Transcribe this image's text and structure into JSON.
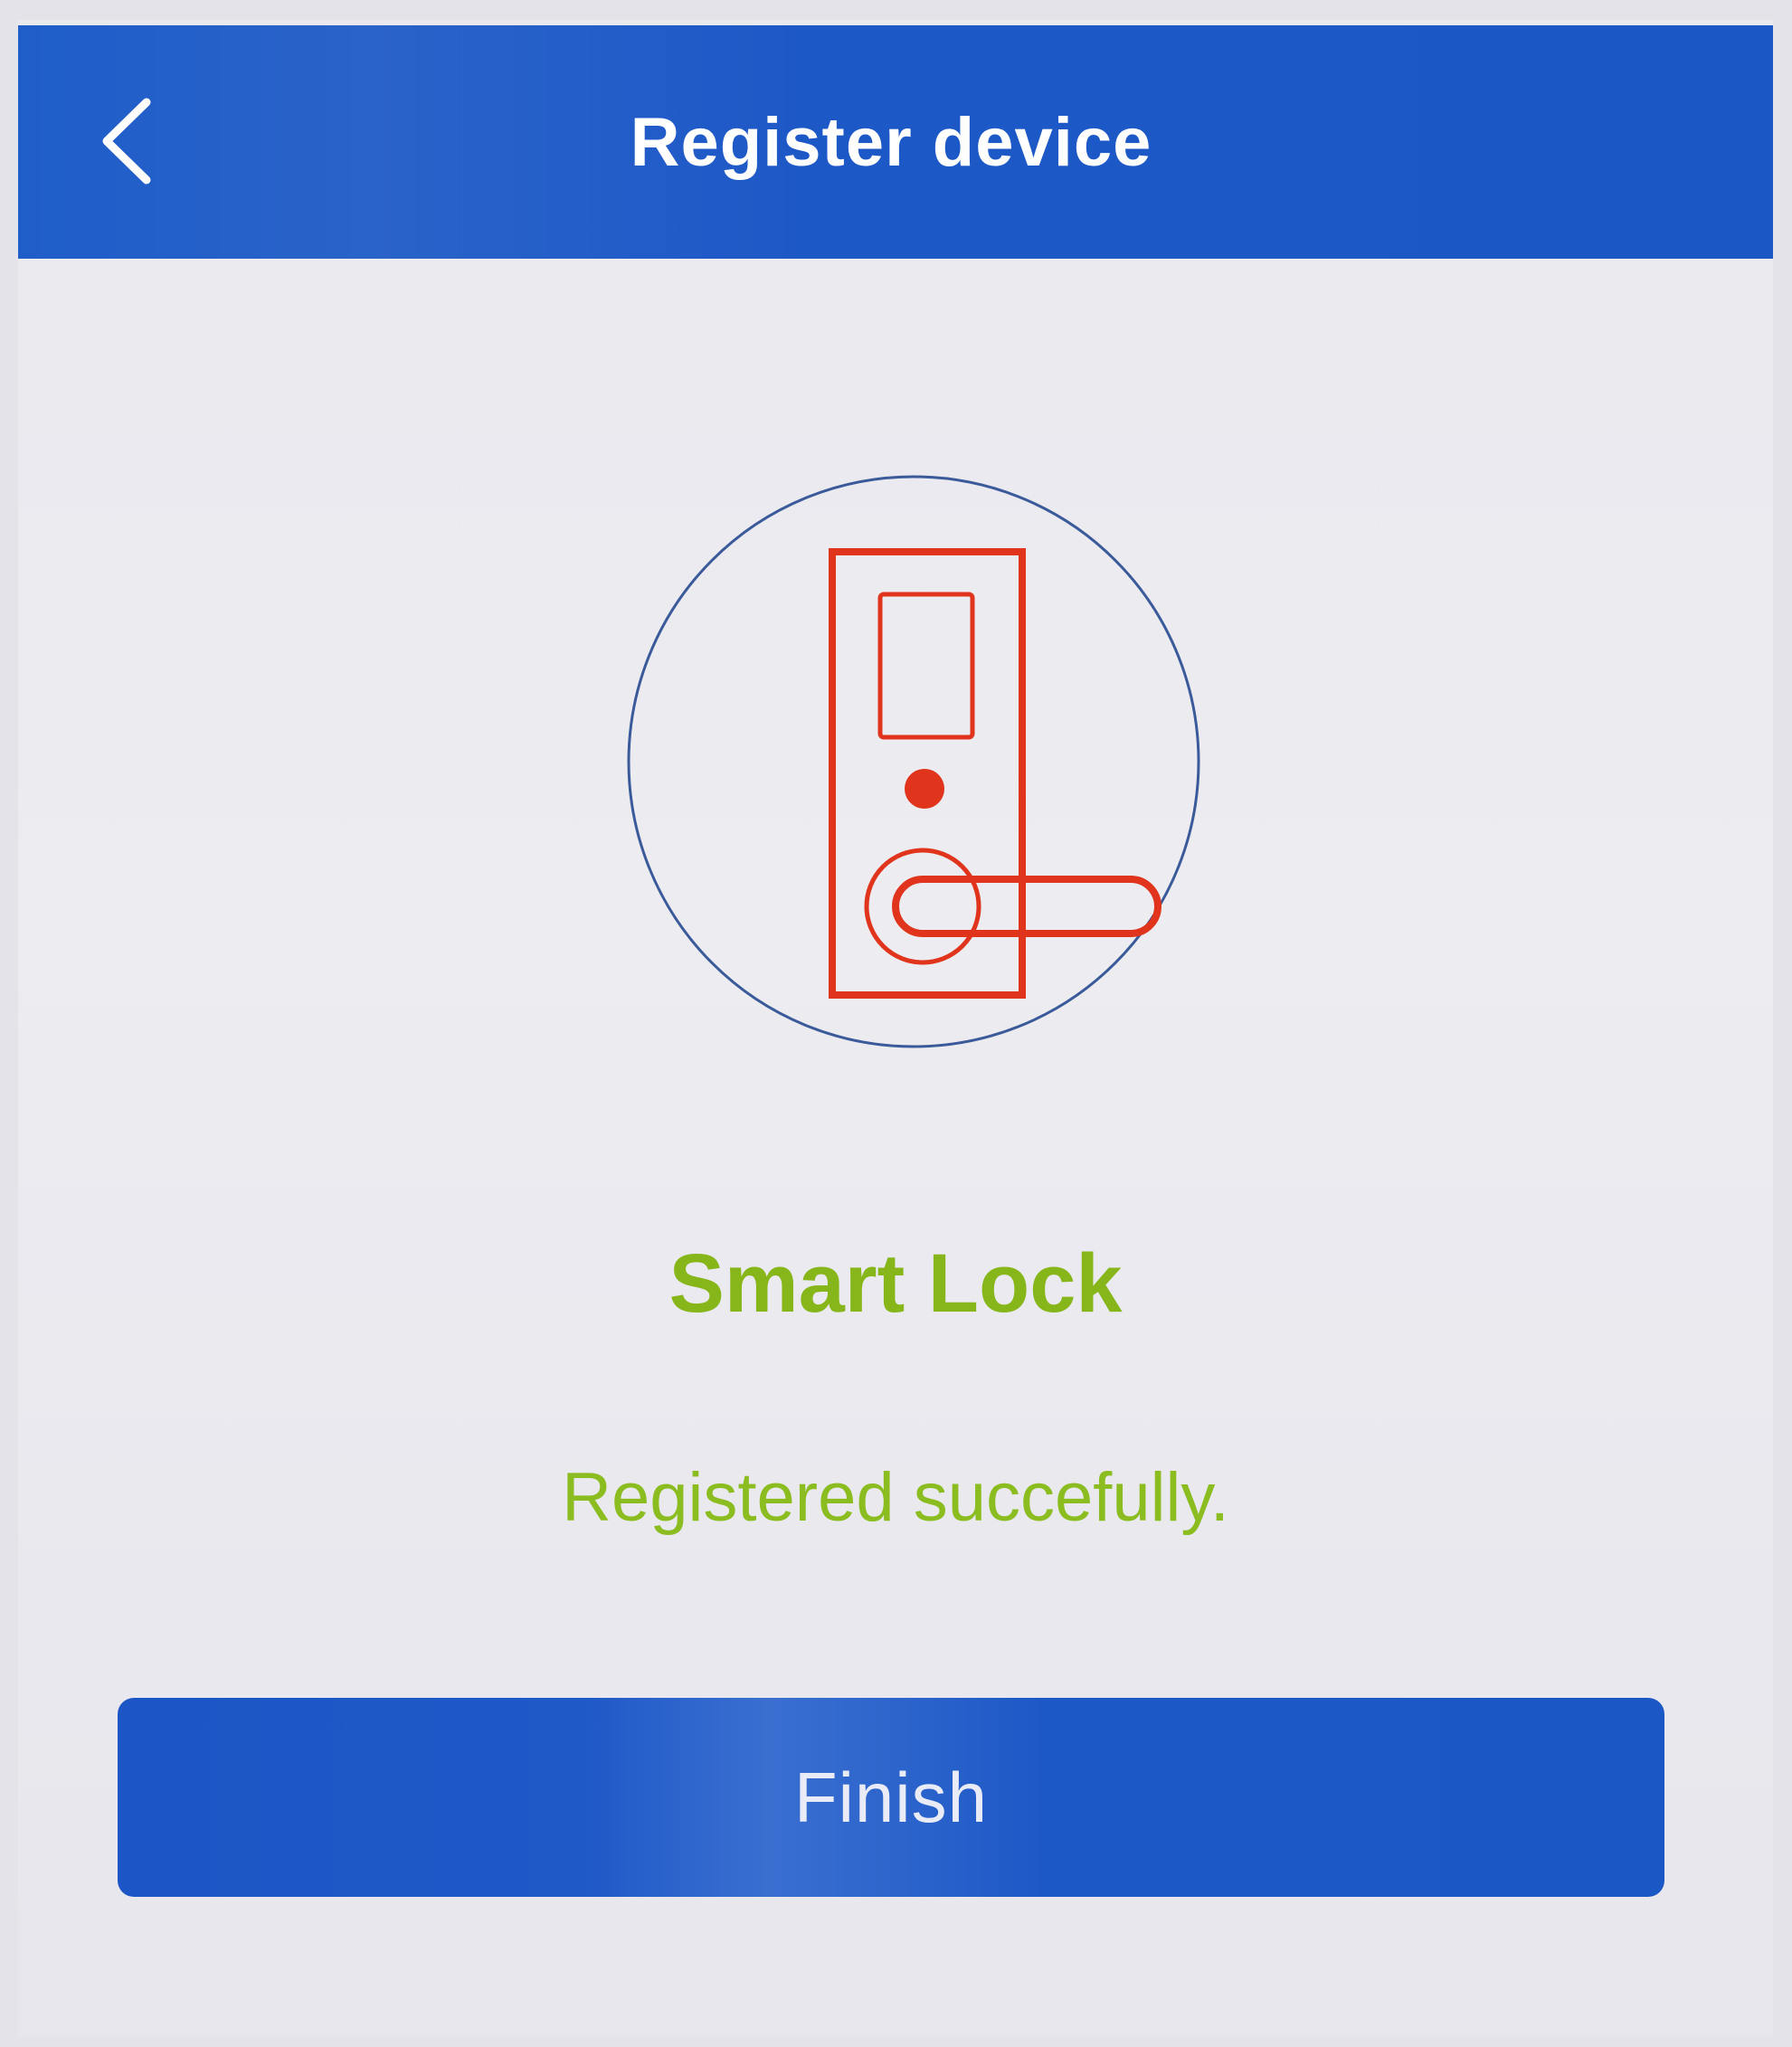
{
  "header": {
    "title": "Register device",
    "back_icon": "chevron-left-icon"
  },
  "device": {
    "illustration_icon": "smart-lock-icon",
    "name": "Smart Lock",
    "status": "Registered succefully."
  },
  "actions": {
    "finish_label": "Finish"
  },
  "colors": {
    "app_bar": "#1c57c6",
    "button": "#1c57c6",
    "lock_outline": "#e0341c",
    "circle_outline": "#3a5a9a",
    "success_text": "#86b61a",
    "background": "#ececf1"
  }
}
